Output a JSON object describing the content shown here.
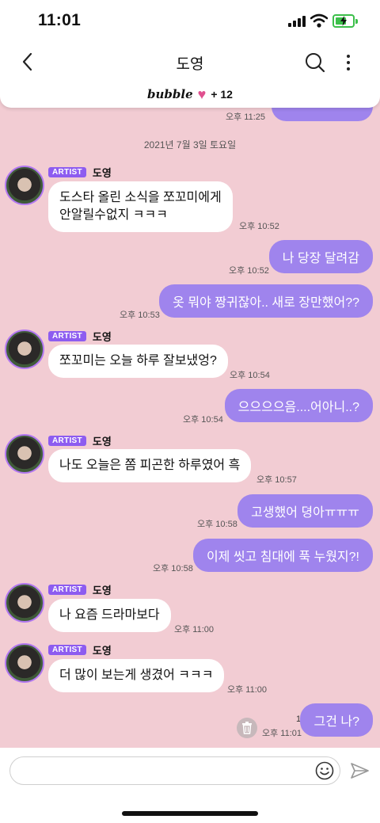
{
  "status_bar": {
    "time": "11:01"
  },
  "header": {
    "title": "도영"
  },
  "banner": {
    "brand": "bubble",
    "heart": "♥",
    "count": "+ 12"
  },
  "prev_time": "오후 11:25",
  "date_separator": "2021년 7월 3일 토요일",
  "artist": {
    "badge": "ARTIST",
    "name": "도영"
  },
  "messages": [
    {
      "from": "artist",
      "lines": [
        "도스타 올린 소식을 쪼꼬미에게",
        "안알릴수없지 ㅋㅋㅋ"
      ],
      "time": "오후 10:52"
    },
    {
      "from": "me",
      "text": "나 당장 달려감",
      "time": "오후 10:52"
    },
    {
      "from": "me",
      "text": "옷 뭐야 짱귀잖아.. 새로 장만했어??",
      "time": "오후 10:53"
    },
    {
      "from": "artist",
      "text": "쪼꼬미는 오늘 하루 잘보냈엉?",
      "time": "오후 10:54"
    },
    {
      "from": "me",
      "text": "으으으으음....어아니..?",
      "time": "오후 10:54"
    },
    {
      "from": "artist",
      "text": "나도 오늘은 쫌 피곤한 하루였어 흑",
      "time": "오후 10:57"
    },
    {
      "from": "me",
      "text": "고생했어 뎡아ㅠㅠㅠ",
      "time": "오후 10:58"
    },
    {
      "from": "me",
      "text": "이제 씻고 침대에 푹 누웠지?!",
      "time": "오후 10:58"
    },
    {
      "from": "artist",
      "text": "나 요즘 드라마보다",
      "time": "오후 11:00"
    },
    {
      "from": "artist",
      "text": "더 많이 보는게 생겼어 ㅋㅋㅋ",
      "time": "오후 11:00"
    },
    {
      "from": "me",
      "text": "그건 나?",
      "time": "오후 11:01",
      "unread": "1"
    }
  ],
  "input": {
    "placeholder": ""
  },
  "icons": {
    "back": "chevron-left-icon",
    "search": "search-icon",
    "more": "more-vertical-icon",
    "emoji": "smile-icon",
    "send": "send-icon",
    "delete": "trash-icon"
  },
  "colors": {
    "chat_background": "#f2ccd3",
    "my_bubble": "#9f84ed",
    "artist_badge": "#8d5cf0",
    "heart": "#e0508f"
  }
}
